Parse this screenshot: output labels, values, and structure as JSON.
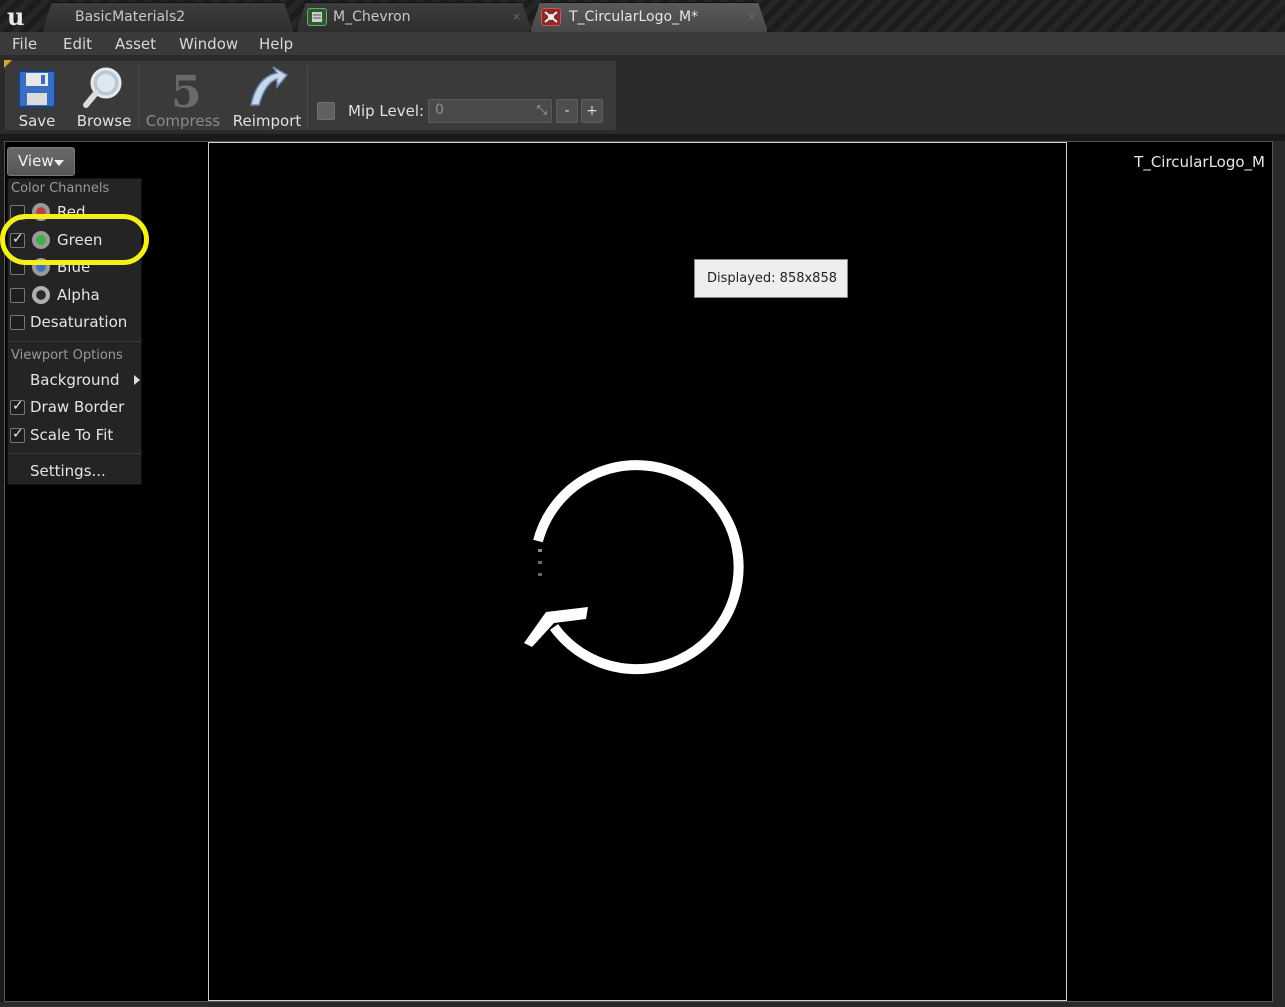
{
  "tabs": [
    {
      "label": "BasicMaterials2",
      "icon": "level-icon"
    },
    {
      "label": "M_Chevron",
      "icon": "material-icon",
      "close": "×"
    },
    {
      "label": "T_CircularLogo_M*",
      "icon": "texture-icon",
      "close": "×"
    }
  ],
  "menu": [
    "File",
    "Edit",
    "Asset",
    "Window",
    "Help"
  ],
  "toolbar": {
    "save_label": "Save",
    "browse_label": "Browse",
    "compress_label": "Compress",
    "reimport_label": "Reimport",
    "mip_label": "Mip Level:",
    "mip_value": "0",
    "mip_minus": "-",
    "mip_plus": "+",
    "mip_enabled": false
  },
  "viewport": {
    "view_button": "View",
    "texture_name": "T_CircularLogo_M",
    "tooltip": "Displayed: 858x858"
  },
  "view_menu": {
    "color_channels_header": "Color Channels",
    "channels": [
      {
        "label": "Red",
        "checked": false,
        "color": "#c04040"
      },
      {
        "label": "Green",
        "checked": true,
        "color": "#40b040"
      },
      {
        "label": "Blue",
        "checked": false,
        "color": "#4070c0"
      },
      {
        "label": "Alpha",
        "checked": false,
        "color": "#b0b0b0"
      }
    ],
    "desaturation_label": "Desaturation",
    "desaturation_checked": false,
    "viewport_options_header": "Viewport Options",
    "background_label": "Background",
    "draw_border_label": "Draw Border",
    "draw_border_checked": true,
    "scale_to_fit_label": "Scale To Fit",
    "scale_to_fit_checked": true,
    "settings_label": "Settings..."
  },
  "colors": {
    "highlight": "#f5ef1a",
    "viewport_bg": "#000000",
    "tab_active": "#4a4a4a"
  }
}
